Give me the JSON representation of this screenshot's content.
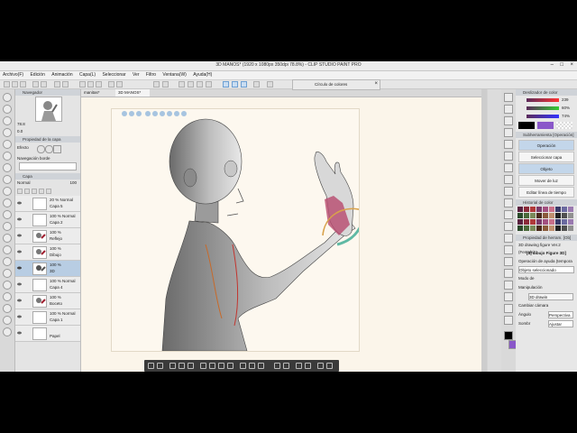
{
  "window": {
    "title": "3D MANOS* (1920 x 1080px 350dpi 78.8%) - CLIP STUDIO PAINT PRO"
  },
  "menu": [
    "Archivo(F)",
    "Edición",
    "Animación",
    "Capa(L)",
    "Seleccionar",
    "Ver",
    "Filtro",
    "Ventana(W)",
    "Ayuda(H)"
  ],
  "navigator": {
    "tab": "Navegador",
    "zoom": "78.8",
    "zoom2": "0.0"
  },
  "layer_property": {
    "title": "Propiedad de la capa",
    "effect_label": "Efecto",
    "render_label": "Navegación borde"
  },
  "layer_panel": {
    "tab": "Capa",
    "blend": "Normal",
    "opacity": "100"
  },
  "layers": [
    {
      "opacity": "20 % Normal",
      "name": "Capa 5"
    },
    {
      "opacity": "100 % Normal",
      "name": "Capa 2"
    },
    {
      "opacity": "100 %",
      "name": "Reflejo"
    },
    {
      "opacity": "100 %",
      "name": "Dibujo"
    },
    {
      "opacity": "100 %",
      "name": "3D"
    },
    {
      "opacity": "100 % Normal",
      "name": "Capa 4"
    },
    {
      "opacity": "100 %",
      "name": "Boceto"
    },
    {
      "opacity": "100 % Normal",
      "name": "Capa 1"
    },
    {
      "opacity": "",
      "name": "Papel"
    }
  ],
  "tabs": [
    "manitas*",
    "3D MANOS*"
  ],
  "color_window": {
    "title": "Círculo de colores"
  },
  "color_panel": {
    "title": "Deslizador de color",
    "r": "239",
    "g": "60%",
    "b": "74%"
  },
  "sub_tool": {
    "title": "Subherramienta [Operación]",
    "items": [
      "Operación",
      "Seleccionar capa",
      "Objeto",
      "Mover de luz",
      "Editar línea de tiempo"
    ]
  },
  "history": {
    "title": "Historial de color"
  },
  "tool_property": {
    "title": "Propiedad de herram. [Ob]",
    "object_label": "3D drawing figure Ver.2 (Female)",
    "section": "[3] dibujo Figure 3D]",
    "op_label": "Operación de ayuda (tempora",
    "selected": "Objeto seleccionado",
    "mode_label": "Modo de",
    "manip_label": "Manipulación",
    "drawing_label": "3D drawin",
    "camera": "Cambiar cámara",
    "angle_label": "Ángulo",
    "angle_value": "Perspectiva",
    "shadow_label": "Sombr",
    "shadow_value": "Ajustar"
  },
  "accent": "#8a58c9",
  "highlight": "#b8cde3"
}
